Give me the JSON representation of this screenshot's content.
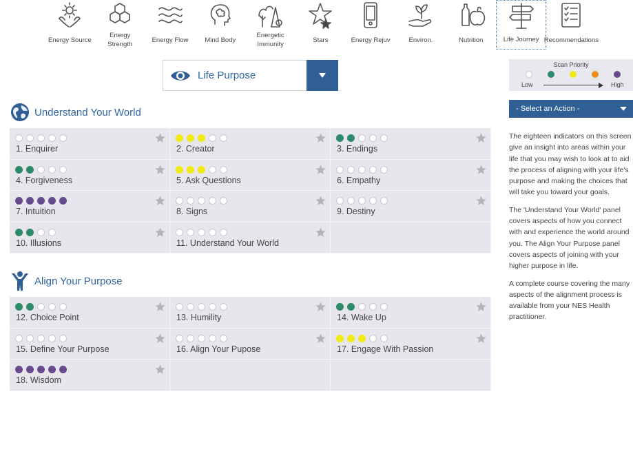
{
  "nav": {
    "items": [
      {
        "label": "Energy Source",
        "icon": "energy-source-icon"
      },
      {
        "label": "Energy\nStrength",
        "icon": "energy-strength-icon"
      },
      {
        "label": "Energy Flow",
        "icon": "energy-flow-icon"
      },
      {
        "label": "Mind Body",
        "icon": "mind-body-icon"
      },
      {
        "label": "Energetic\nImmunity",
        "icon": "energetic-immunity-icon"
      },
      {
        "label": "Stars",
        "icon": "stars-icon"
      },
      {
        "label": "Energy Rejuv",
        "icon": "phone-icon"
      },
      {
        "label": "Environ.",
        "icon": "hand-plant-icon"
      },
      {
        "label": "Nutrition",
        "icon": "nutrition-icon"
      },
      {
        "label": "Life Journey",
        "icon": "signpost-icon",
        "active": true
      },
      {
        "label": "Recommendations",
        "icon": "checklist-icon"
      }
    ]
  },
  "section_select": {
    "label": "Life Purpose",
    "icon": "eye-icon"
  },
  "groups": [
    {
      "title": "Understand Your World",
      "icon": "globe-icon",
      "items": [
        {
          "label": "1. Enquirer",
          "level": 0,
          "color": "none"
        },
        {
          "label": "2. Creator",
          "level": 3,
          "color": "yellow"
        },
        {
          "label": "3. Endings",
          "level": 2,
          "color": "green"
        },
        {
          "label": "4. Forgiveness",
          "level": 2,
          "color": "green"
        },
        {
          "label": "5. Ask Questions",
          "level": 3,
          "color": "yellow"
        },
        {
          "label": "6. Empathy",
          "level": 0,
          "color": "none"
        },
        {
          "label": "7. Intuition",
          "level": 5,
          "color": "purple"
        },
        {
          "label": "8. Signs",
          "level": 0,
          "color": "none"
        },
        {
          "label": "9. Destiny",
          "level": 0,
          "color": "none"
        },
        {
          "label": "10. Illusions",
          "level": 2,
          "color": "green",
          "dots": 4
        },
        {
          "label": "11. Understand Your World",
          "level": 0,
          "color": "none"
        }
      ]
    },
    {
      "title": "Align Your Purpose",
      "icon": "person-arms-up-icon",
      "items": [
        {
          "label": "12. Choice Point",
          "level": 2,
          "color": "green"
        },
        {
          "label": "13. Humility",
          "level": 0,
          "color": "none"
        },
        {
          "label": "14. Wake Up",
          "level": 2,
          "color": "green"
        },
        {
          "label": "15. Define Your Purpose",
          "level": 0,
          "color": "none"
        },
        {
          "label": "16. Align Your Pupose",
          "level": 0,
          "color": "none"
        },
        {
          "label": "17. Engage With Passion",
          "level": 3,
          "color": "yellow"
        },
        {
          "label": "18. Wisdom",
          "level": 5,
          "color": "purple"
        }
      ]
    }
  ],
  "legend": {
    "title": "Scan Priority",
    "low": "Low",
    "high": "High",
    "colors": [
      "#ffffff",
      "#2e8b6a",
      "#f0ea14",
      "#f08c1e",
      "#6a4a8e"
    ]
  },
  "action_select": {
    "label": "- Select an Action -"
  },
  "description": [
    "The eighteen indicators on this screen give an insight into areas within your life that you may wish to look at to aid the process of aligning with your life's purpose and making the choices that will take you toward your goals.",
    "The 'Understand Your World' panel covers aspects of how you connect with and experience the world around you. The Align Your Purpose panel covers aspects of joining with your higher purpose in life.",
    "A complete course covering the many aspects of the alignment process is available from your NES Health practitioner."
  ],
  "colors": {
    "accent": "#2f5f94",
    "title_blue": "#2e66a0",
    "green": "#2e8b6a",
    "yellow": "#f0ea14",
    "purple": "#6a4a8e",
    "orange": "#f08c1e",
    "panel": "#e6e6ec"
  }
}
